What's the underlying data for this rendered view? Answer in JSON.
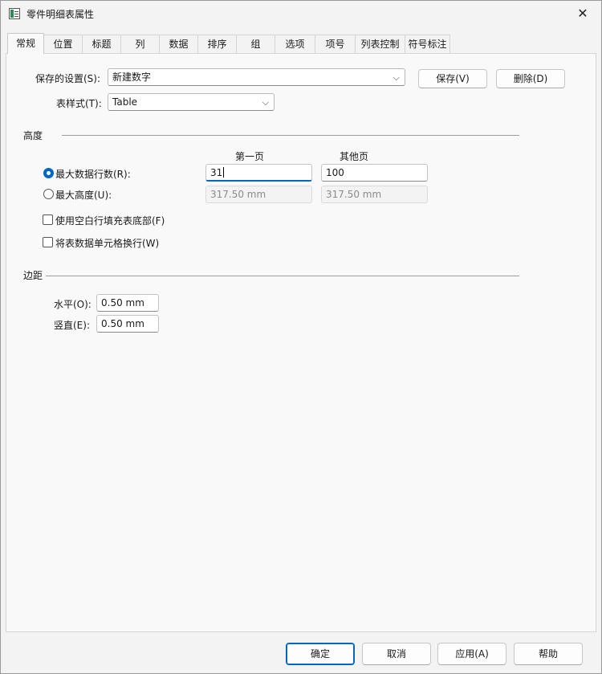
{
  "window": {
    "title": "零件明细表属性",
    "close_glyph": "✕"
  },
  "tabs": [
    {
      "label": "常规",
      "active": true
    },
    {
      "label": "位置"
    },
    {
      "label": "标题"
    },
    {
      "label": "列"
    },
    {
      "label": "数据"
    },
    {
      "label": "排序"
    },
    {
      "label": "组"
    },
    {
      "label": "选项"
    },
    {
      "label": "项号"
    },
    {
      "label": "列表控制"
    },
    {
      "label": "符号标注"
    }
  ],
  "settings": {
    "saved_label": "保存的设置(S):",
    "saved_value": "新建数字",
    "save_button": "保存(V)",
    "delete_button": "删除(D)",
    "style_label": "表样式(T):",
    "style_value": "Table"
  },
  "height": {
    "title": "高度",
    "col_first": "第一页",
    "col_other": "其他页",
    "max_rows_label": "最大数据行数(R):",
    "max_rows_first": "31",
    "max_rows_other": "100",
    "max_height_label": "最大高度(U):",
    "max_height_first": "317.50 mm",
    "max_height_other": "317.50 mm",
    "fill_blank_label": "使用空白行填充表底部(F)",
    "wrap_label": "将表数据单元格换行(W)"
  },
  "margin": {
    "title": "边距",
    "horizontal_label": "水平(O):",
    "horizontal_value": "0.50 mm",
    "vertical_label": "竖直(E):",
    "vertical_value": "0.50 mm"
  },
  "footer": {
    "ok": "确定",
    "cancel": "取消",
    "apply": "应用(A)",
    "help": "帮助"
  },
  "icons": {
    "dropdown": "chevron-down-icon",
    "close": "close-icon"
  },
  "colors": {
    "accent": "#0067c0"
  }
}
